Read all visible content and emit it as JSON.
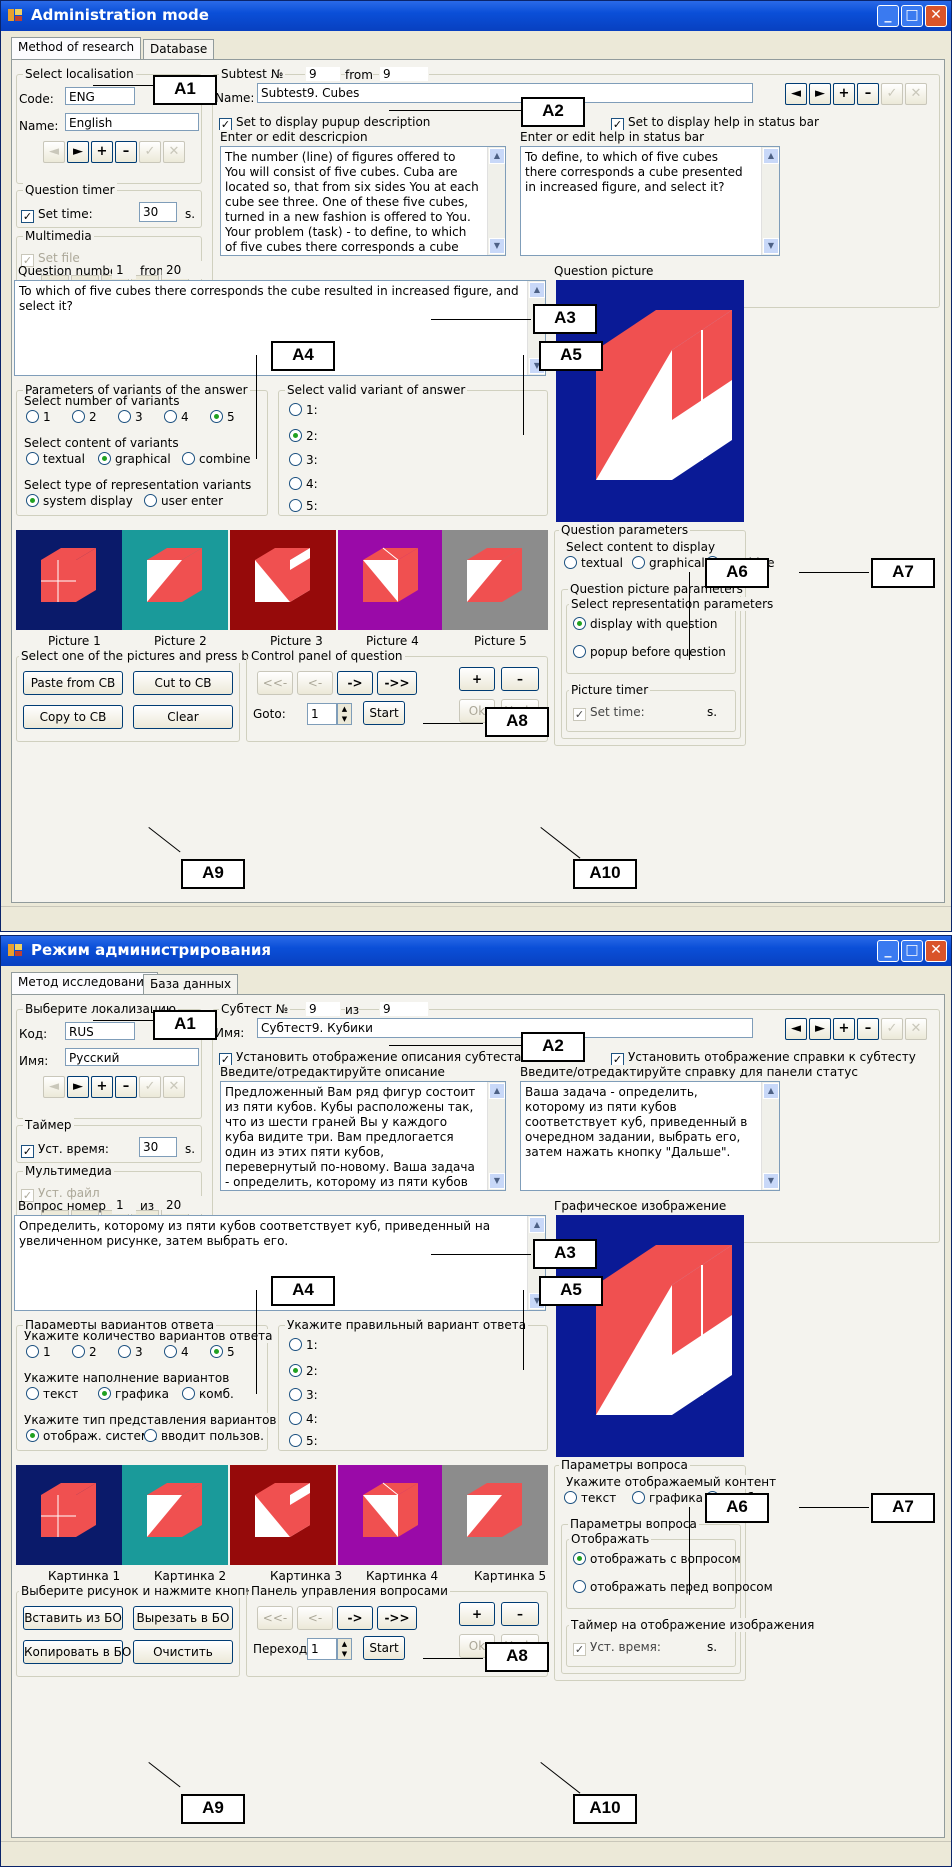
{
  "windows": [
    {
      "title": "Administration mode",
      "tabs": [
        "Method of research",
        "Database"
      ],
      "localisation": {
        "group": "Select localisation",
        "code_label": "Code:",
        "code_value": "ENG",
        "name_label": "Name:",
        "name_value": "English"
      },
      "timer": {
        "group": "Question timer",
        "check_label": "Set time:",
        "value": "30",
        "unit": "s."
      },
      "multimedia": {
        "group": "Multimedia",
        "check_label": "Set file"
      },
      "subtest": {
        "label": "Subtest  №",
        "number": "9",
        "from_label": "from",
        "from_value": "9",
        "name_label": "Name:",
        "name_value": "Subtest9. Cubes"
      },
      "popup": {
        "check_label": "Set to display pupup description",
        "desc_group": "Enter or edit descricpion",
        "desc_text": "The number (line) of figures offered to You will consist of five cubes. Cuba are located so, that from six sides You at each cube see three. One of these five cubes, turned in a new fashion is offered to You. Your problem (task) - to define, to which of five cubes there corresponds a cube presented in the task, to choose it, then to press"
      },
      "help": {
        "check_label": "Set to display help in status bar",
        "group": "Enter or edit help in status bar",
        "text": "To define, to which of five cubes there corresponds a cube presented in increased figure, and select it?"
      },
      "question": {
        "number_label": "Question number",
        "number": "1",
        "from_label": "from",
        "from_value": "20",
        "text": "To which of five cubes there corresponds the cube resulted in increased figure, and select it?"
      },
      "question_picture_label": "Question picture",
      "params": {
        "group": "Parameters of variants of the answer",
        "num_group": "Select number of variants",
        "num_options": [
          "1",
          "2",
          "3",
          "4",
          "5"
        ],
        "content_group": "Select content of variants",
        "content_options": [
          "textual",
          "graphical",
          "combine"
        ],
        "repr_group": "Select type of representation variants",
        "repr_options": [
          "system display",
          "user enter"
        ]
      },
      "valid": {
        "group": "Select valid variant of answer",
        "options": [
          "1:",
          "2:",
          "3:",
          "4:",
          "5:"
        ]
      },
      "qparams": {
        "group": "Question parameters",
        "content_group": "Select content to display",
        "content_options": [
          "textual",
          "graphical",
          "combine"
        ],
        "pic_group": "Question picture parameters",
        "repr_group": "Select representation parameters",
        "repr_options": [
          "display with question",
          "popup before question"
        ],
        "timer_group": "Picture timer",
        "timer_label": "Set time:",
        "timer_unit": "s."
      },
      "pictures": [
        "Picture 1",
        "Picture 2",
        "Picture 3",
        "Picture 4",
        "Picture 5"
      ],
      "clip": {
        "group": "Select one of the pictures and press button",
        "buttons": [
          "Paste from CB",
          "Cut to CB",
          "Copy to CB",
          "Clear"
        ]
      },
      "control": {
        "group": "Control panel of question",
        "nav": [
          "<<-",
          "<-",
          "->",
          "->>"
        ],
        "goto_label": "Goto:",
        "goto_value": "1",
        "start": "Start"
      },
      "edit_buttons": [
        "+",
        "–",
        "Ok",
        "Undo"
      ]
    },
    {
      "title": "Режим администрирования",
      "tabs": [
        "Метод исследования",
        "База данных"
      ],
      "localisation": {
        "group": "Выберите локализацию",
        "code_label": "Код:",
        "code_value": "RUS",
        "name_label": "Имя:",
        "name_value": "Русский"
      },
      "timer": {
        "group": "Таймер",
        "check_label": "Уст. время:",
        "value": "30",
        "unit": "s."
      },
      "multimedia": {
        "group": "Мультимедиа",
        "check_label": "Уст. файл"
      },
      "subtest": {
        "label": "Субтест  №",
        "number": "9",
        "from_label": "из",
        "from_value": "9",
        "name_label": "Имя:",
        "name_value": "Субтест9. Кубики"
      },
      "popup": {
        "check_label": "Установить отображение описания субтеста",
        "desc_group": "Введите/отредактируйте описание",
        "desc_text": "Предложенный Вам ряд фигур состоит из пяти кубов. Кубы расположены так, что из шести граней Вы у каждого куба видите три. Вам предлогается один из этих пяти кубов, перевернутый по-новому. Ваша задача - определить, которому из пяти кубов соответствует куб, приведенный"
      },
      "help": {
        "check_label": "Установить отображение справки к субтесту",
        "group": "Введите/отредактируйте справку для панели статус",
        "text": "Ваша задача - определить, которому из пяти кубов соответствует куб, приведенный в очередном задании, выбрать его, затем нажать кнопку \"Дальше\"."
      },
      "question": {
        "number_label": "Вопрос номер",
        "number": "1",
        "from_label": "из",
        "from_value": "20",
        "text": "Определить, которому из пяти кубов соответствует куб, приведенный на увеличенном рисунке, затем выбрать его."
      },
      "question_picture_label": "Графическое изображение",
      "params": {
        "group": "Парамерты вариантов ответа",
        "num_group": "Укажите количество вариантов ответа",
        "num_options": [
          "1",
          "2",
          "3",
          "4",
          "5"
        ],
        "content_group": "Укажите наполнение вариантов",
        "content_options": [
          "текст",
          "графика",
          "комб."
        ],
        "repr_group": "Укажите тип представления вариантов",
        "repr_options": [
          "отображ. система",
          "вводит пользов."
        ]
      },
      "valid": {
        "group": "Укажите правильный вариант ответа",
        "options": [
          "1:",
          "2:",
          "3:",
          "4:",
          "5:"
        ]
      },
      "qparams": {
        "group": "Параметры вопроса",
        "content_group": "Укажите отображаемый контент",
        "content_options": [
          "текст",
          "графика",
          "комб."
        ],
        "pic_group": "Параметры вопроса",
        "repr_group": "Отображать",
        "repr_options": [
          "отображать с вопросом",
          "отображать перед вопросом"
        ],
        "timer_group": "Таймер на отображение изображения",
        "timer_label": "Уст. время:",
        "timer_unit": "s."
      },
      "pictures": [
        "Картинка 1",
        "Картинка 2",
        "Картинка 3",
        "Картинка 4",
        "Картинка 5"
      ],
      "clip": {
        "group": "Выберите рисунок и нажмите кнопку",
        "buttons": [
          "Вставить из БО",
          "Вырезать в БО",
          "Копировать в БО",
          "Очистить"
        ]
      },
      "control": {
        "group": "Панель управления вопросами",
        "nav": [
          "<<-",
          "<-",
          "->",
          "->>"
        ],
        "goto_label": "Переход:",
        "goto_value": "1",
        "start": "Start"
      },
      "edit_buttons": [
        "+",
        "–",
        "Ok",
        "Undo"
      ]
    }
  ],
  "annotations": [
    "A1",
    "A2",
    "A3",
    "A4",
    "A5",
    "A6",
    "A7",
    "A8",
    "A9",
    "A10"
  ],
  "colors": {
    "titlebar": "#0a4fd8",
    "picture_backgrounds": [
      "#0a1a6a",
      "#1a9a9a",
      "#960a0a",
      "#9a0aa8",
      "#8c8c8c"
    ],
    "question_picture_bg": "#0a1a96",
    "cube_face": "#f05050"
  }
}
